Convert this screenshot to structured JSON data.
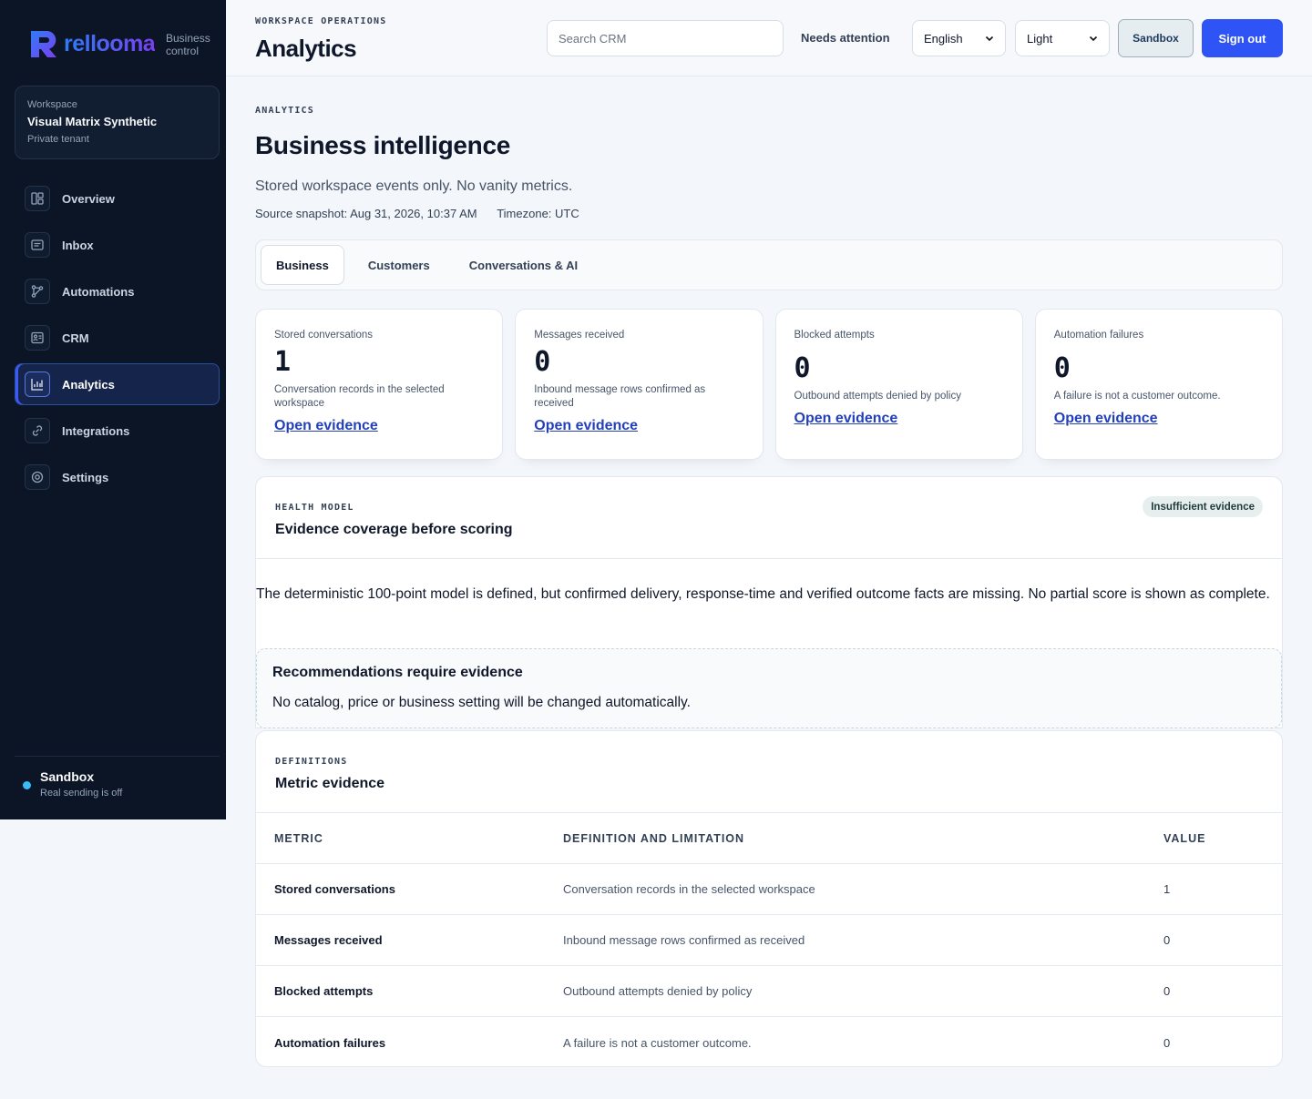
{
  "brand": {
    "name": "rellooma",
    "subtitle_line1": "Business",
    "subtitle_line2": "control"
  },
  "workspace": {
    "label": "Workspace",
    "name": "Visual Matrix Synthetic",
    "tenant": "Private tenant"
  },
  "nav": [
    {
      "label": "Overview",
      "icon": "overview-icon",
      "active": false
    },
    {
      "label": "Inbox",
      "icon": "inbox-icon",
      "active": false
    },
    {
      "label": "Automations",
      "icon": "automations-icon",
      "active": false
    },
    {
      "label": "CRM",
      "icon": "crm-icon",
      "active": false
    },
    {
      "label": "Analytics",
      "icon": "analytics-icon",
      "active": true
    },
    {
      "label": "Integrations",
      "icon": "integrations-icon",
      "active": false
    },
    {
      "label": "Settings",
      "icon": "settings-icon",
      "active": false
    }
  ],
  "sidebar_footer": {
    "title": "Sandbox",
    "subtitle": "Real sending is off",
    "dot_color": "#38bdf8"
  },
  "header": {
    "eyebrow": "WORKSPACE OPERATIONS",
    "title": "Analytics",
    "search_placeholder": "Search CRM",
    "needs_attention": "Needs attention",
    "language": "English",
    "theme": "Light",
    "sandbox_button": "Sandbox",
    "signout_button": "Sign out"
  },
  "page": {
    "eyebrow": "ANALYTICS",
    "title": "Business intelligence",
    "description": "Stored workspace events only. No vanity metrics.",
    "snapshot": "Source snapshot: Aug 31, 2026, 10:37 AM",
    "timezone": "Timezone: UTC"
  },
  "tabs": [
    {
      "label": "Business",
      "active": true
    },
    {
      "label": "Customers",
      "active": false
    },
    {
      "label": "Conversations & AI",
      "active": false
    }
  ],
  "kpis": [
    {
      "label": "Stored conversations",
      "value": "1",
      "description": "Conversation records in the selected workspace",
      "link": "Open evidence"
    },
    {
      "label": "Messages received",
      "value": "0",
      "description": "Inbound message rows confirmed as received",
      "link": "Open evidence"
    },
    {
      "label": "Blocked attempts",
      "value": "0",
      "description": "Outbound attempts denied by policy",
      "link": "Open evidence"
    },
    {
      "label": "Automation failures",
      "value": "0",
      "description": "A failure is not a customer outcome.",
      "link": "Open evidence"
    }
  ],
  "health": {
    "eyebrow": "HEALTH MODEL",
    "title": "Evidence coverage before scoring",
    "badge": "Insufficient evidence",
    "text": "The deterministic 100-point model is defined, but confirmed delivery, response-time and verified outcome facts are missing. No partial score is shown as complete.",
    "rec_title": "Recommendations require evidence",
    "rec_text": "No catalog, price or business setting will be changed automatically."
  },
  "definitions": {
    "eyebrow": "DEFINITIONS",
    "title": "Metric evidence",
    "columns": [
      "METRIC",
      "DEFINITION AND LIMITATION",
      "VALUE"
    ],
    "rows": [
      {
        "metric": "Stored conversations",
        "definition": "Conversation records in the selected workspace",
        "value": "1"
      },
      {
        "metric": "Messages received",
        "definition": "Inbound message rows confirmed as received",
        "value": "0"
      },
      {
        "metric": "Blocked attempts",
        "definition": "Outbound attempts denied by policy",
        "value": "0"
      },
      {
        "metric": "Automation failures",
        "definition": "A failure is not a customer outcome.",
        "value": "0"
      }
    ]
  },
  "colors": {
    "accent": "#2f54f5",
    "sidebar_bg": "#0b1526",
    "link": "#2440b8"
  }
}
